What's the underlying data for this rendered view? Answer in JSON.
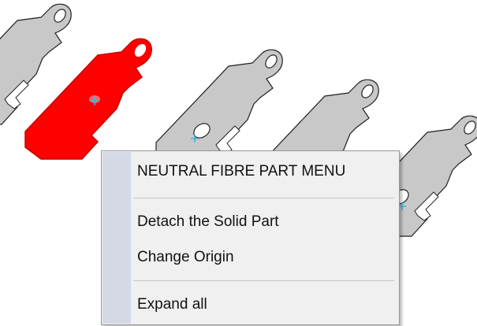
{
  "viewport": {
    "parts": [
      {
        "name": "part-1",
        "state": "unselected"
      },
      {
        "name": "part-2",
        "state": "selected"
      },
      {
        "name": "part-3",
        "state": "unselected"
      },
      {
        "name": "part-4",
        "state": "unselected"
      },
      {
        "name": "part-5",
        "state": "unselected"
      }
    ],
    "colors": {
      "part_face": "#c8c8c8",
      "part_side": "#9e9e9e",
      "part_edge": "#222222",
      "selected": "#ff0000",
      "selected_dark": "#c80000",
      "origin_marker": "#36b7d8",
      "background": "#ffffff"
    }
  },
  "context_menu": {
    "header": "NEUTRAL FIBRE PART MENU",
    "items": [
      {
        "label": "Detach the Solid Part"
      },
      {
        "label": "Change Origin"
      },
      {
        "label": "Expand all"
      }
    ],
    "colors": {
      "background": "#f0f0f0",
      "gutter": "#d5d9e6",
      "border": "#979797",
      "separator": "#c6c6c6"
    }
  }
}
